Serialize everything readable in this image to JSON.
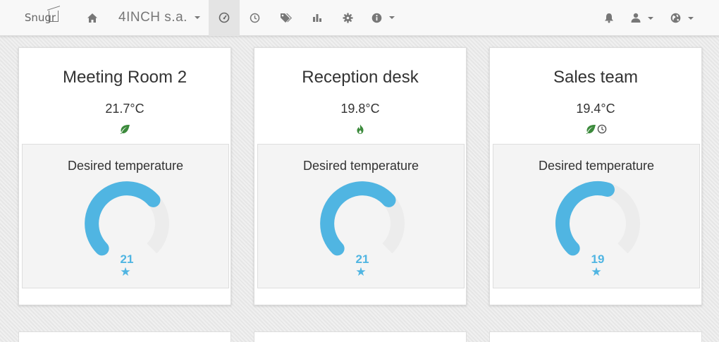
{
  "navbar": {
    "logo_text": "Snugr",
    "company": "4INCH s.a.",
    "icons": [
      "home-icon",
      "dashboard-icon",
      "clock-icon",
      "tags-icon",
      "bar-chart-icon",
      "gear-icon",
      "info-icon",
      "bell-icon",
      "user-icon",
      "globe-icon"
    ]
  },
  "colors": {
    "accent": "#50b5e2",
    "gauge_track": "#ececec",
    "leaf_green": "#3c8a3c"
  },
  "cards": [
    {
      "title": "Meeting Room 2",
      "temperature": "21.7°C",
      "status_icons": [
        "leaf-icon"
      ],
      "desired_label": "Desired temperature",
      "desired_value": "21",
      "gauge_fraction": 0.68,
      "star": "★"
    },
    {
      "title": "Reception desk",
      "temperature": "19.8°C",
      "status_icons": [
        "flame-icon"
      ],
      "desired_label": "Desired temperature",
      "desired_value": "21",
      "gauge_fraction": 0.68,
      "star": "★"
    },
    {
      "title": "Sales team",
      "temperature": "19.4°C",
      "status_icons": [
        "leaf-icon",
        "clock-icon"
      ],
      "desired_label": "Desired temperature",
      "desired_value": "19",
      "gauge_fraction": 0.56,
      "star": "★"
    }
  ]
}
